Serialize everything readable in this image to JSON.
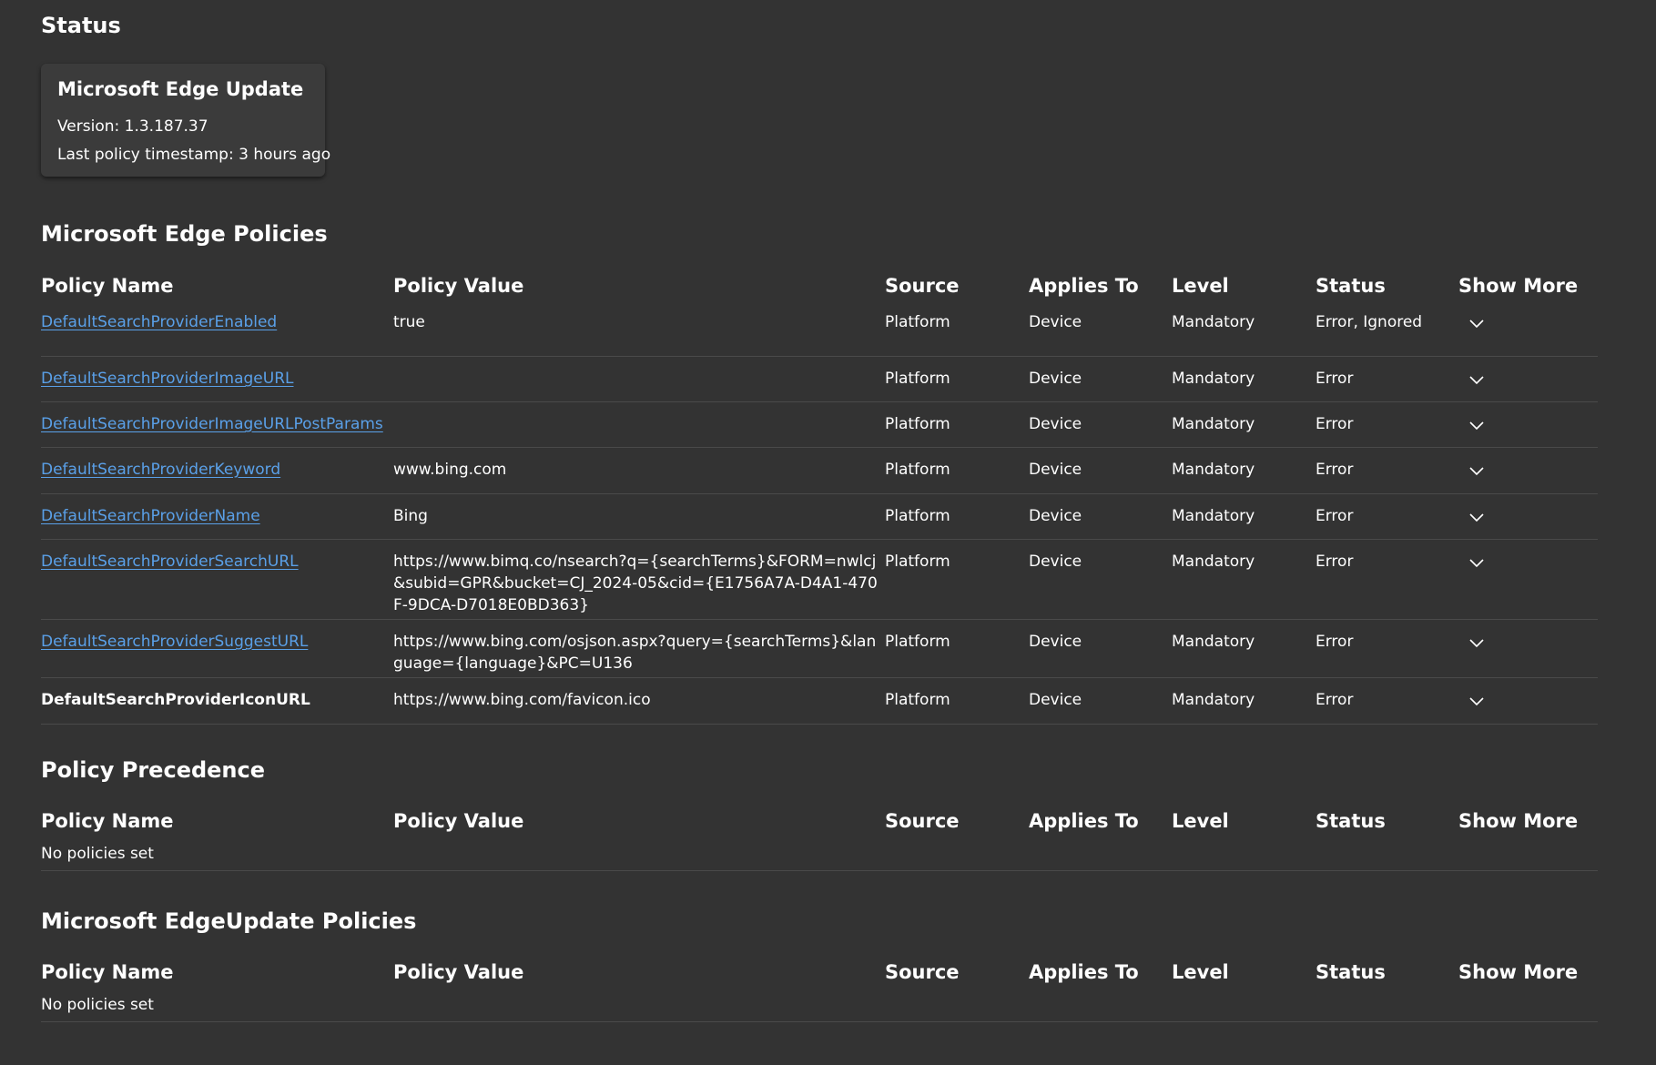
{
  "status_section": {
    "title": "Status",
    "card": {
      "title": "Microsoft Edge Update",
      "version": "Version: 1.3.187.37",
      "timestamp": "Last policy timestamp: 3 hours ago"
    }
  },
  "columns": {
    "name": "Policy Name",
    "value": "Policy Value",
    "source": "Source",
    "applies": "Applies To",
    "level": "Level",
    "status": "Status",
    "more": "Show More"
  },
  "edge_policies": {
    "title": "Microsoft Edge Policies",
    "rows": [
      {
        "name": "DefaultSearchProviderEnabled",
        "value": "true",
        "source": "Platform",
        "applies": "Device",
        "level": "Mandatory",
        "status": "Error, Ignored"
      },
      {
        "name": "DefaultSearchProviderImageURL",
        "value": "",
        "source": "Platform",
        "applies": "Device",
        "level": "Mandatory",
        "status": "Error"
      },
      {
        "name": "DefaultSearchProviderImageURLPostParams",
        "value": "",
        "source": "Platform",
        "applies": "Device",
        "level": "Mandatory",
        "status": "Error"
      },
      {
        "name": "DefaultSearchProviderKeyword",
        "value": "www.bing.com",
        "source": "Platform",
        "applies": "Device",
        "level": "Mandatory",
        "status": "Error"
      },
      {
        "name": "DefaultSearchProviderName",
        "value": "Bing",
        "source": "Platform",
        "applies": "Device",
        "level": "Mandatory",
        "status": "Error"
      },
      {
        "name": "DefaultSearchProviderSearchURL",
        "value": "https://www.bimq.co/nsearch?q={searchTerms}&FORM=nwlcj&subid=GPR&bucket=CJ_2024-05&cid={E1756A7A-D4A1-470F-9DCA-D7018E0BD363}",
        "source": "Platform",
        "applies": "Device",
        "level": "Mandatory",
        "status": "Error"
      },
      {
        "name": "DefaultSearchProviderSuggestURL",
        "value": "https://www.bing.com/osjson.aspx?query={searchTerms}&language={language}&PC=U136",
        "source": "Platform",
        "applies": "Device",
        "level": "Mandatory",
        "status": "Error"
      },
      {
        "name": "DefaultSearchProviderIconURL",
        "value": "https://www.bing.com/favicon.ico",
        "source": "Platform",
        "applies": "Device",
        "level": "Mandatory",
        "status": "Error"
      }
    ]
  },
  "precedence": {
    "title": "Policy Precedence",
    "empty": "No policies set"
  },
  "edgeupdate": {
    "title": "Microsoft EdgeUpdate Policies",
    "empty": "No policies set"
  },
  "colors": {
    "background": "#333333",
    "card": "#3b3b3b",
    "link": "#5aa0e8",
    "divider": "#4a4a4a"
  },
  "icons": {
    "expand": "chevron-down-icon"
  }
}
